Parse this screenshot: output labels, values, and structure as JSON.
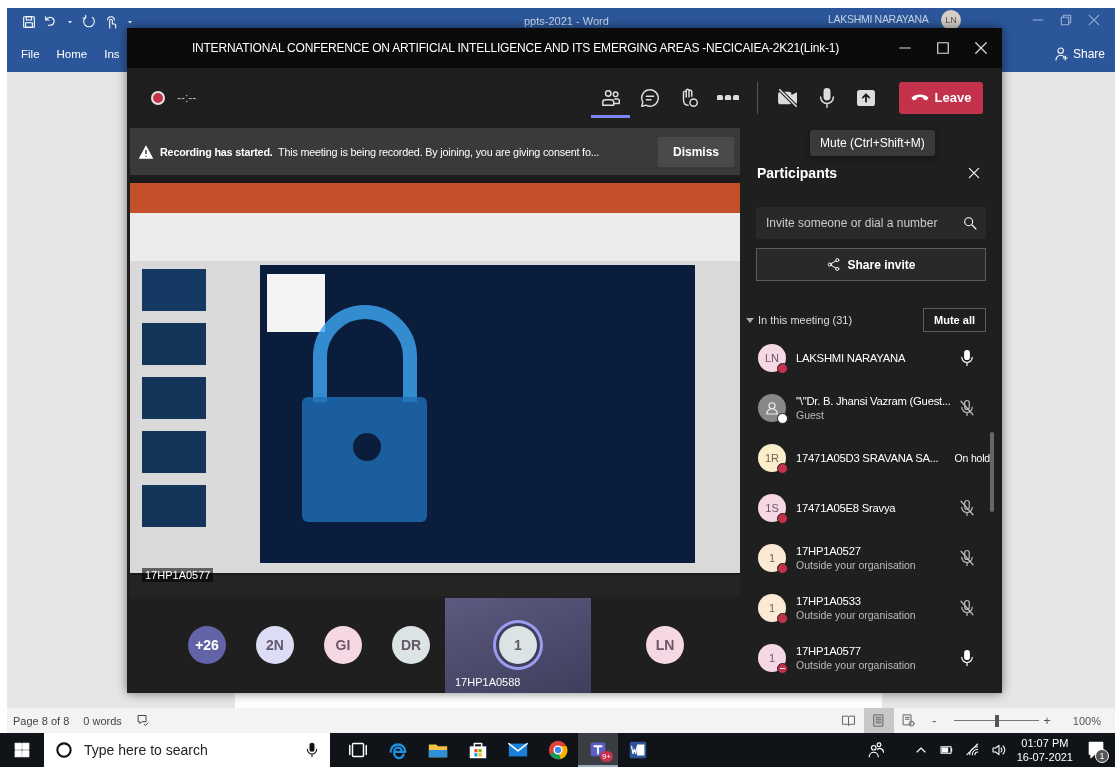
{
  "word": {
    "title": "ppts-2021  -  Word",
    "user": "LAKSHMI NARAYANA",
    "user_initials": "LN",
    "tabs": [
      {
        "label": "File"
      },
      {
        "label": "Home"
      },
      {
        "label": "Ins"
      }
    ],
    "share": "Share",
    "status": {
      "page": "Page 8 of 8",
      "words": "0 words",
      "views": [
        {
          "kind": "read",
          "selected": false
        },
        {
          "kind": "print",
          "selected": true
        },
        {
          "kind": "web",
          "selected": false
        }
      ],
      "zoom_out": "-",
      "zoom_slider": {
        "level": 0.5
      },
      "zoom_in": "+",
      "zoom": "100%"
    }
  },
  "teams": {
    "title": "INTERNATIONAL CONFERENCE ON ARTIFICIAL INTELLIGENCE AND ITS EMERGING AREAS -NECICAIEA-2K21(Link-1)",
    "recording_time": "--:--",
    "actions": [
      {
        "kind": "participants",
        "selected": true
      },
      {
        "kind": "chat",
        "selected": false
      },
      {
        "kind": "reactions",
        "selected": false
      },
      {
        "kind": "more",
        "selected": false
      }
    ],
    "devices": [
      {
        "kind": "camera",
        "on": false
      },
      {
        "kind": "mic",
        "on": true
      },
      {
        "kind": "share"
      }
    ],
    "leave": "Leave",
    "tooltip": "Mute (Ctrl+Shift+M)",
    "banner": {
      "title": "Recording has started.",
      "text": "This meeting is being recorded. By joining, you are giving consent fo...",
      "button": "Dismiss"
    },
    "shared_screen": {
      "kind": "picture",
      "presenter": "17HP1A0577"
    },
    "gallery": [
      {
        "initials": "+26",
        "color": "#6264a7",
        "selected": false
      },
      {
        "initials": "2N",
        "color": "#dcdcf4",
        "selected": false
      },
      {
        "initials": "GI",
        "color": "#f5d8e3",
        "selected": false
      },
      {
        "initials": "DR",
        "color": "#dbe3e4",
        "selected": false
      },
      {
        "initials": "1",
        "color": "#dbe3e4",
        "selected": true,
        "name": "17HP1A0588"
      },
      {
        "initials": "LN",
        "color": "#f5d8e3",
        "selected": false
      }
    ]
  },
  "participants_panel": {
    "title": "Participants",
    "search_placeholder": "Invite someone or dial a number",
    "share_invite": "Share invite",
    "section": {
      "label": "In this meeting (31)",
      "expanded": true,
      "mute_all": "Mute all"
    },
    "items": [
      {
        "name": "LAKSHMI NARAYANA",
        "initials": "LN",
        "color": "#f5d8e3",
        "presence": {
          "kind": "busy",
          "color": "#c4314b"
        },
        "muted": false
      },
      {
        "name": "\"\\\"Dr. B. Jhansi Vazram (Guest...",
        "subtitle": "Guest",
        "color": "#8a8886",
        "presence": {
          "kind": "busy",
          "color": "#ffffff"
        },
        "muted": true
      },
      {
        "name": "17471A05D3 SRAVANA SA...",
        "initials": "1R",
        "color": "#fbefcb",
        "presence": {
          "kind": "busy",
          "color": "#c4314b"
        },
        "state": "On hold"
      },
      {
        "name": "17471A05E8 Sravya",
        "initials": "1S",
        "color": "#f5d8e3",
        "presence": {
          "kind": "busy",
          "color": "#c4314b"
        },
        "muted": true
      },
      {
        "name": "17HP1A0527",
        "subtitle": "Outside your organisation",
        "initials": "1",
        "color": "#fbead3",
        "presence": {
          "kind": "busy",
          "color": "#c4314b"
        },
        "muted": true
      },
      {
        "name": "17HP1A0533",
        "subtitle": "Outside your organisation",
        "initials": "1",
        "color": "#fbead3",
        "presence": {
          "kind": "busy",
          "color": "#c4314b"
        },
        "muted": true
      },
      {
        "name": "17HP1A0577",
        "subtitle": "Outside your organisation",
        "initials": "1",
        "color": "#f5d8e3",
        "presence": {
          "kind": "dnd",
          "color": "#c4314b"
        },
        "muted": false
      }
    ]
  },
  "taskbar": {
    "search_placeholder": "Type here to search",
    "apps": [
      {
        "kind": "taskview",
        "selected": false
      },
      {
        "kind": "edge",
        "selected": false
      },
      {
        "kind": "explorer",
        "selected": false
      },
      {
        "kind": "store",
        "selected": false
      },
      {
        "kind": "mail",
        "selected": false
      },
      {
        "kind": "chrome",
        "selected": false
      },
      {
        "kind": "teams",
        "selected": true,
        "badge": "9+"
      },
      {
        "kind": "word",
        "selected": false
      }
    ],
    "time": "01:07 PM",
    "date": "16-07-2021",
    "notifications": "1"
  }
}
